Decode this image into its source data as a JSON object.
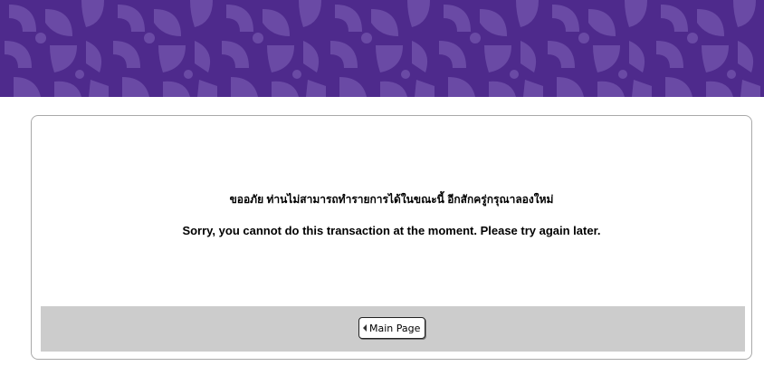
{
  "banner": {
    "background_color": "#4e2a8c",
    "pattern_color": "#6a4aa5"
  },
  "message": {
    "thai": "ขออภัย ท่านไม่สามารถทำรายการได้ในขณะนี้ อีกสักครู่กรุณาลองใหม่",
    "english": "Sorry, you cannot do this transaction at the moment. Please try again later."
  },
  "footer": {
    "main_page_button": "Main Page",
    "button_icon": "left-triangle-icon"
  }
}
